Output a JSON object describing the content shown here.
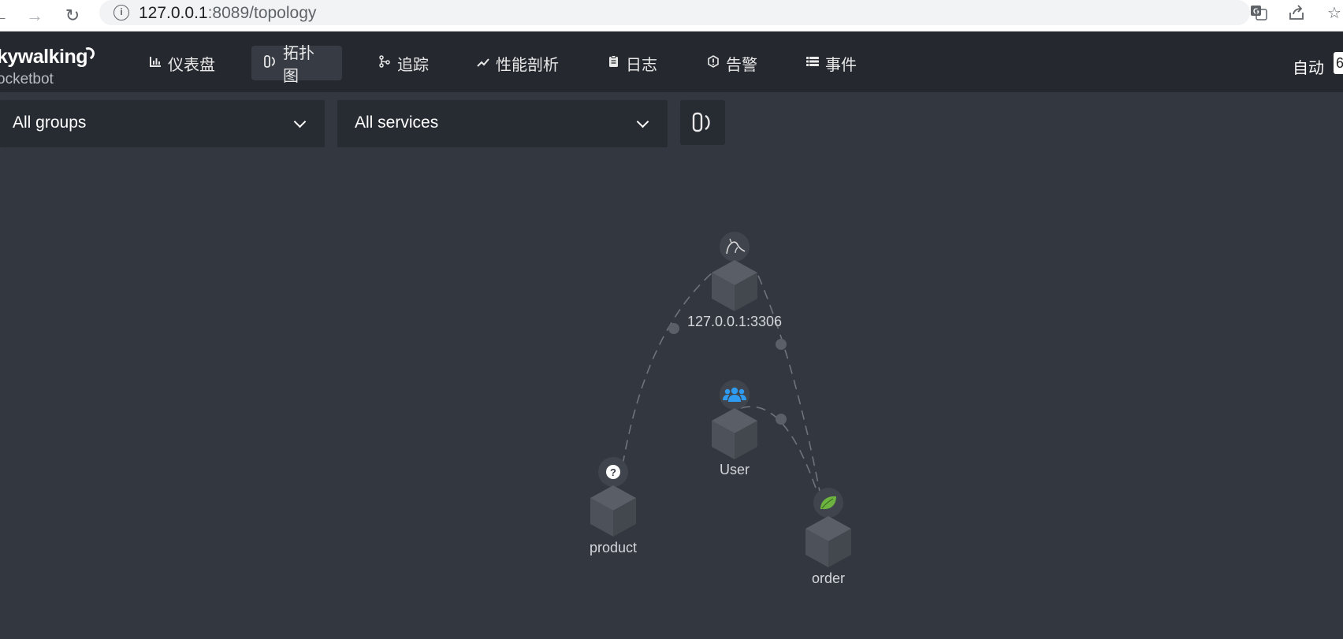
{
  "browser": {
    "url_host": "127.0.0.1",
    "url_rest": ":8089/topology",
    "back_icon": "back-arrow-icon",
    "forward_icon": "forward-arrow-icon",
    "reload_icon": "reload-icon"
  },
  "app": {
    "logo_main": "kywalking",
    "logo_sub": "ocketbot",
    "nav": [
      {
        "label": "仪表盘",
        "icon": "dashboard-chart-icon"
      },
      {
        "label": "拓扑图",
        "icon": "topology-icon",
        "active": true
      },
      {
        "label": "追踪",
        "icon": "trace-icon"
      },
      {
        "label": "性能剖析",
        "icon": "profile-line-icon"
      },
      {
        "label": "日志",
        "icon": "log-clipboard-icon"
      },
      {
        "label": "告警",
        "icon": "alarm-icon"
      },
      {
        "label": "事件",
        "icon": "event-list-icon"
      }
    ],
    "auto_label": "自动",
    "auto_value": "6"
  },
  "filters": {
    "group_select": "All groups",
    "service_select": "All services"
  },
  "topology": {
    "nodes": [
      {
        "id": "mysql",
        "label": "127.0.0.1:3306",
        "icon": "mysql-dolphin-icon"
      },
      {
        "id": "user",
        "label": "User",
        "icon": "users-icon"
      },
      {
        "id": "product",
        "label": "product",
        "icon": "question-icon"
      },
      {
        "id": "order",
        "label": "order",
        "icon": "spring-leaf-icon"
      }
    ],
    "links": [
      {
        "from": "product",
        "to": "mysql"
      },
      {
        "from": "order",
        "to": "mysql"
      },
      {
        "from": "user",
        "to": "order"
      }
    ],
    "colors": {
      "background": "#333840",
      "header": "#25292f",
      "link": "#6f737a",
      "users_icon": "#2f9bf0",
      "spring_leaf": "#6db33f"
    }
  }
}
